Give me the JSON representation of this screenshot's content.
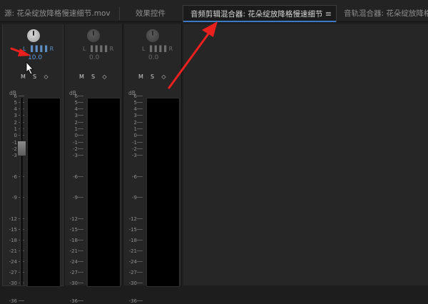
{
  "tabs": [
    {
      "label": "源: 花朵绽放降格慢速细节.mov"
    },
    {
      "label": "效果控件"
    },
    {
      "label": "音频剪辑混合器: 花朵绽放降格慢速细节",
      "menu": "≡"
    },
    {
      "label": "音轨混合器: 花朵绽放降格慢速细节"
    }
  ],
  "mixer": {
    "channels": [
      {
        "lr": "L ▐▐▐▐ R",
        "pan": "10.0"
      },
      {
        "lr": "L ▐▐▐▐ R",
        "pan": "0.0"
      },
      {
        "lr": "L ▐▐▐▐ R",
        "pan": "0.0"
      }
    ],
    "buttons": {
      "mute": "M",
      "solo": "S",
      "keyframe": "◇"
    },
    "db_label": "dB",
    "scale_ticks": [
      "6",
      "5",
      "4",
      "3",
      "2",
      "1",
      "0",
      "-1",
      "-2",
      "-3",
      "-6",
      "-9",
      "-12",
      "-15",
      "-18",
      "-21",
      "-24",
      "-27",
      "-30",
      "-36"
    ]
  },
  "colors": {
    "annotation": "#e8211e",
    "accent": "#3a78c8"
  }
}
